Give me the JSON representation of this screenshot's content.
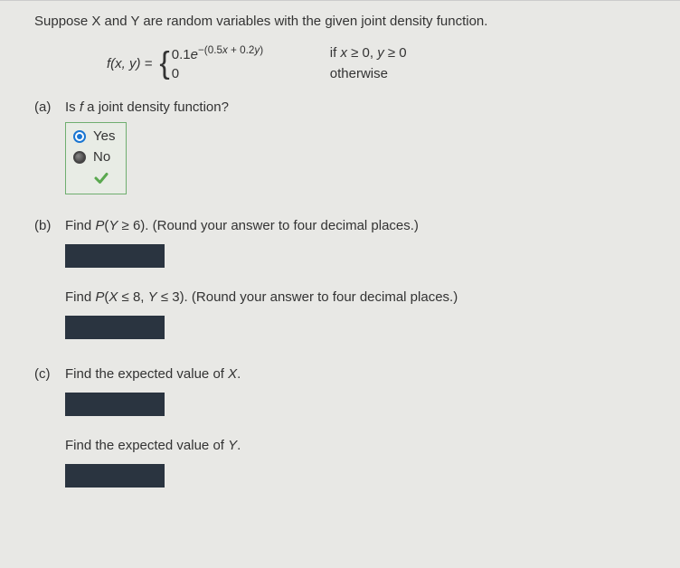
{
  "intro": "Suppose X and Y are random variables with the given joint density function.",
  "formula": {
    "lhs": "f(x, y) = ",
    "case1_expr_html": "<span class='norm'>0.1</span>e<sup><span class='norm'>−(0.5</span>x<span class='norm'> + 0.2</span>y<span class='norm'>)</span></sup>",
    "case1_cond_html": "if <span class='var'>x</span> ≥ 0, <span class='var'>y</span> ≥ 0",
    "case2_expr": "0",
    "case2_cond": "otherwise"
  },
  "parts": {
    "a": {
      "label": "(a)",
      "question_html": "Is <i>f</i> a joint density function?",
      "options": {
        "yes": "Yes",
        "no": "No"
      },
      "selected": "yes",
      "correct": true
    },
    "b": {
      "label": "(b)",
      "q1_html": "Find <i>P</i>(<i>Y</i> ≥ 6). (Round your answer to four decimal places.)",
      "q2_html": "Find <i>P</i>(<i>X</i> ≤ 8, <i>Y</i> ≤ 3). (Round your answer to four decimal places.)"
    },
    "c": {
      "label": "(c)",
      "q1_html": "Find the expected value of <i>X</i>.",
      "q2_html": "Find the expected value of <i>Y</i>."
    }
  }
}
